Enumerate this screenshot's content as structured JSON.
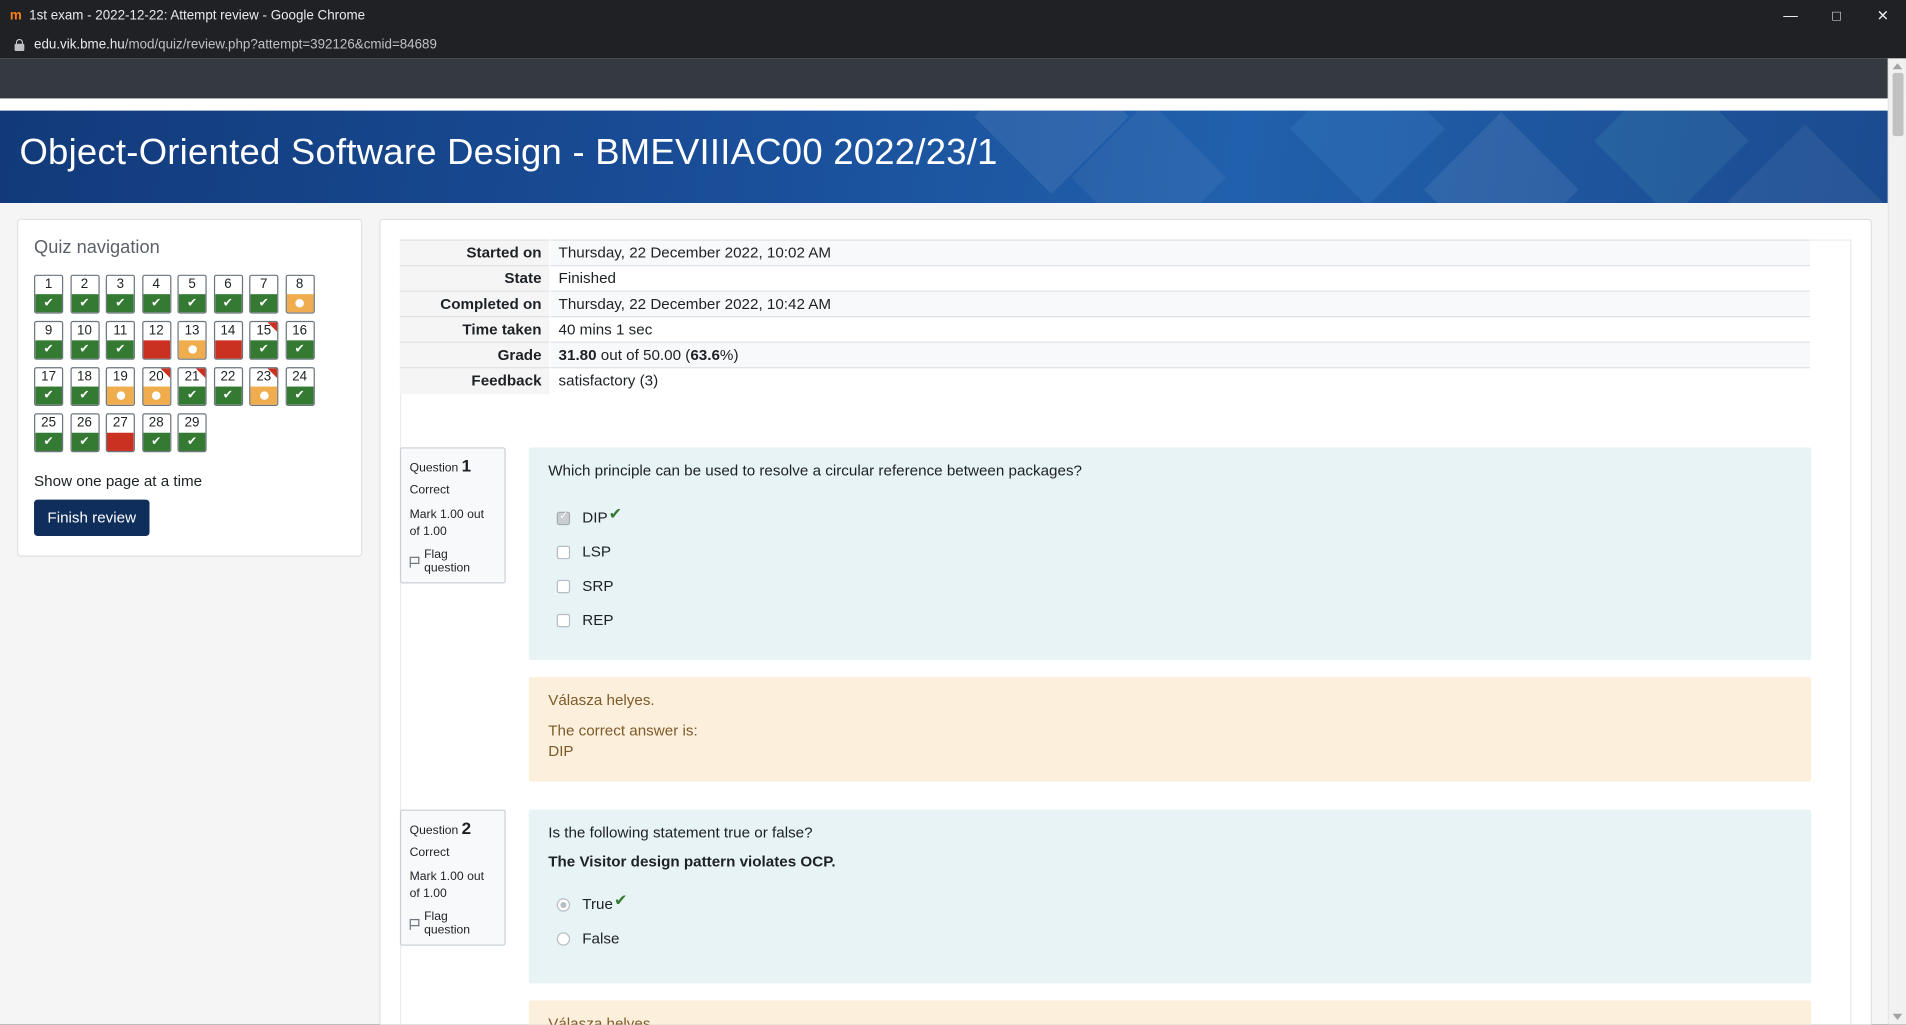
{
  "browser": {
    "window_title": "1st exam - 2022-12-22: Attempt review - Google Chrome",
    "url_host": "edu.vik.bme.hu",
    "url_path": "/mod/quiz/review.php?attempt=392126&cmid=84689"
  },
  "course": {
    "title": "Object-Oriented Software Design - BMEVIIIAC00 2022/23/1"
  },
  "quiz_nav": {
    "heading": "Quiz navigation",
    "questions": [
      {
        "n": "1",
        "s": "ok",
        "f": false
      },
      {
        "n": "2",
        "s": "ok",
        "f": false
      },
      {
        "n": "3",
        "s": "ok",
        "f": false
      },
      {
        "n": "4",
        "s": "ok",
        "f": false
      },
      {
        "n": "5",
        "s": "ok",
        "f": false
      },
      {
        "n": "6",
        "s": "ok",
        "f": false
      },
      {
        "n": "7",
        "s": "ok",
        "f": false
      },
      {
        "n": "8",
        "s": "part",
        "f": false
      },
      {
        "n": "9",
        "s": "ok",
        "f": false
      },
      {
        "n": "10",
        "s": "ok",
        "f": false
      },
      {
        "n": "11",
        "s": "ok",
        "f": false
      },
      {
        "n": "12",
        "s": "bad",
        "f": false
      },
      {
        "n": "13",
        "s": "part",
        "f": false
      },
      {
        "n": "14",
        "s": "bad",
        "f": false
      },
      {
        "n": "15",
        "s": "ok",
        "f": true
      },
      {
        "n": "16",
        "s": "ok",
        "f": false
      },
      {
        "n": "17",
        "s": "ok",
        "f": false
      },
      {
        "n": "18",
        "s": "ok",
        "f": false
      },
      {
        "n": "19",
        "s": "part",
        "f": false
      },
      {
        "n": "20",
        "s": "part",
        "f": true
      },
      {
        "n": "21",
        "s": "ok",
        "f": true
      },
      {
        "n": "22",
        "s": "ok",
        "f": false
      },
      {
        "n": "23",
        "s": "part",
        "f": true
      },
      {
        "n": "24",
        "s": "ok",
        "f": false
      },
      {
        "n": "25",
        "s": "ok",
        "f": false
      },
      {
        "n": "26",
        "s": "ok",
        "f": false
      },
      {
        "n": "27",
        "s": "bad",
        "f": false
      },
      {
        "n": "28",
        "s": "ok",
        "f": false
      },
      {
        "n": "29",
        "s": "ok",
        "f": false
      }
    ],
    "show_one_page": "Show one page at a time",
    "finish_review": "Finish review"
  },
  "summary": [
    {
      "label": "Started on",
      "value": "Thursday, 22 December 2022, 10:02 AM"
    },
    {
      "label": "State",
      "value": "Finished"
    },
    {
      "label": "Completed on",
      "value": "Thursday, 22 December 2022, 10:42 AM"
    },
    {
      "label": "Time taken",
      "value": "40 mins 1 sec"
    },
    {
      "label": "Grade",
      "grade_score": "31.80",
      "grade_mid": " out of 50.00 (",
      "grade_pct": "63.6",
      "grade_end": "%)"
    },
    {
      "label": "Feedback",
      "value": "satisfactory (3)"
    }
  ],
  "questions": [
    {
      "prefix": "Question ",
      "number": "1",
      "state": "Correct",
      "mark": "Mark 1.00 out of 1.00",
      "flag": "Flag question",
      "text": "Which principle can be used to resolve a circular reference between packages?",
      "options": [
        "DIP",
        "LSP",
        "SRP",
        "REP"
      ],
      "selected": 0,
      "feedback_status": "Válasza helyes.",
      "feedback_label": "The correct answer is:",
      "feedback_answer": "DIP"
    },
    {
      "prefix": "Question ",
      "number": "2",
      "state": "Correct",
      "mark": "Mark 1.00 out of 1.00",
      "flag": "Flag question",
      "text": "Is the following statement true or false?",
      "statement": "The Visitor design pattern violates OCP.",
      "options": [
        "True",
        "False"
      ],
      "selected": 0,
      "feedback_status": "Válasza helyes."
    }
  ]
}
